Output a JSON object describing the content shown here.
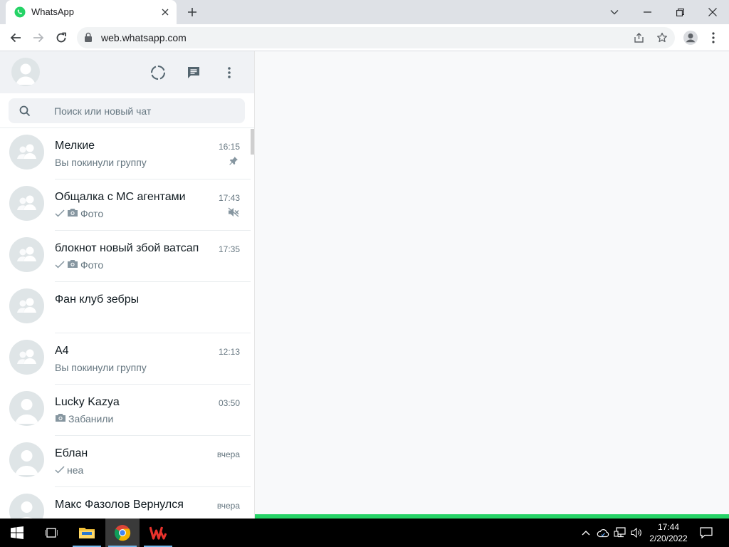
{
  "browser": {
    "tab_title": "WhatsApp",
    "url": "web.whatsapp.com"
  },
  "search": {
    "placeholder": "Поиск или новый чат"
  },
  "chats": [
    {
      "name": "Мелкие",
      "time": "16:15",
      "preview": "Вы покинули группу",
      "avatar": "group",
      "ticks": "none",
      "media": "none",
      "flag": "pin-icon"
    },
    {
      "name": "Общалка с МС агентами",
      "time": "17:43",
      "preview": "Фото",
      "avatar": "group",
      "ticks": "single",
      "media": "camera",
      "flag": "muted-icon"
    },
    {
      "name": "блокнот новый збой ватсап",
      "time": "17:35",
      "preview": "Фото",
      "avatar": "group",
      "ticks": "single",
      "media": "camera",
      "flag": "none"
    },
    {
      "name": "Фан клуб зебры",
      "time": "",
      "preview": "",
      "avatar": "group",
      "ticks": "none",
      "media": "none",
      "flag": "none"
    },
    {
      "name": "А4",
      "time": "12:13",
      "preview": "Вы покинули группу",
      "avatar": "group",
      "ticks": "none",
      "media": "none",
      "flag": "none"
    },
    {
      "name": "Lucky Kazya",
      "time": "03:50",
      "preview": "Забанили",
      "avatar": "person",
      "ticks": "none",
      "media": "camera",
      "flag": "none"
    },
    {
      "name": "Еблан",
      "time": "вчера",
      "preview": "неа",
      "avatar": "person",
      "ticks": "single",
      "media": "none",
      "flag": "none"
    },
    {
      "name": "Макс Фазолов Вернулся",
      "time": "вчера",
      "preview": "",
      "avatar": "person",
      "ticks": "none",
      "media": "none",
      "flag": "none"
    }
  ],
  "taskbar": {
    "time": "17:44",
    "date": "2/20/2022"
  },
  "colors": {
    "accent": "#25d366",
    "header_bg": "#f0f2f5",
    "avatar_bg": "#dfe5e7",
    "icon_gray": "#54656f"
  }
}
